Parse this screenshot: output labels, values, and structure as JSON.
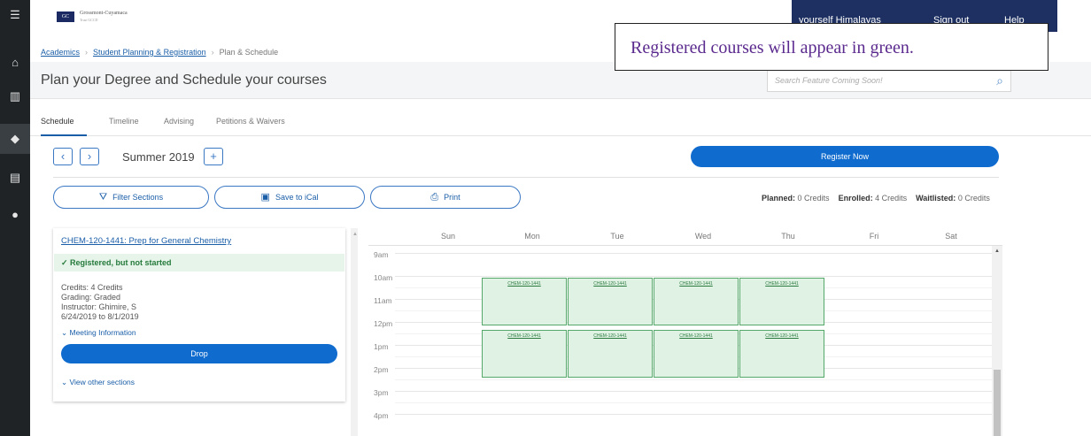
{
  "topbar": {
    "logo_mark": "GC",
    "logo_name": "Grossmont-Cuyamaca",
    "logo_sub": "Trust GCCD",
    "user_text": "yourself Himalayas",
    "signout_label": "Sign out",
    "help_label": "Help"
  },
  "callout": {
    "text": "Registered courses will appear in green."
  },
  "breadcrumb": [
    "Academics",
    "Student Planning & Registration",
    "Plan & Schedule"
  ],
  "page_title": "Plan your Degree and Schedule your courses",
  "search": {
    "placeholder": "Search Feature Coming Soon!"
  },
  "tabs": [
    "Schedule",
    "Timeline",
    "Advising",
    "Petitions & Waivers"
  ],
  "term": {
    "label": "Summer 2019",
    "prev": "‹",
    "next": "›",
    "add": "+"
  },
  "register_now": "Register Now",
  "actions": {
    "filter": "Filter Sections",
    "ical": "Save to iCal",
    "print": "Print"
  },
  "credits": {
    "planned_label": "Planned:",
    "planned_value": "0 Credits",
    "enrolled_label": "Enrolled:",
    "enrolled_value": "4 Credits",
    "waitlisted_label": "Waitlisted:",
    "waitlisted_value": "0 Credits"
  },
  "course": {
    "title": "CHEM-120-1441: Prep for General Chemistry",
    "status": "✓ Registered, but not started",
    "credits": "Credits: 4 Credits",
    "grading": "Grading: Graded",
    "instructor": "Instructor: Ghimire, S",
    "dates": "6/24/2019 to 8/1/2019",
    "meeting_link": "Meeting Information",
    "drop": "Drop",
    "other_sections": "View other sections"
  },
  "calendar": {
    "days": [
      "Sun",
      "Mon",
      "Tue",
      "Wed",
      "Thu",
      "Fri",
      "Sat"
    ],
    "times": [
      "9am",
      "10am",
      "11am",
      "12pm",
      "1pm",
      "2pm",
      "3pm",
      "4pm"
    ],
    "event_label": "CHEM-120-1441"
  },
  "icons": {
    "menu": "menu-icon",
    "home": "home-icon",
    "bank": "institution-icon",
    "grad": "graduation-cap-icon",
    "book": "book-icon",
    "person": "person-icon"
  },
  "colors": {
    "primary": "#0f6bce",
    "registered_bg": "#dff2e3",
    "registered_border": "#55a86a",
    "navbar": "#1d3061"
  }
}
